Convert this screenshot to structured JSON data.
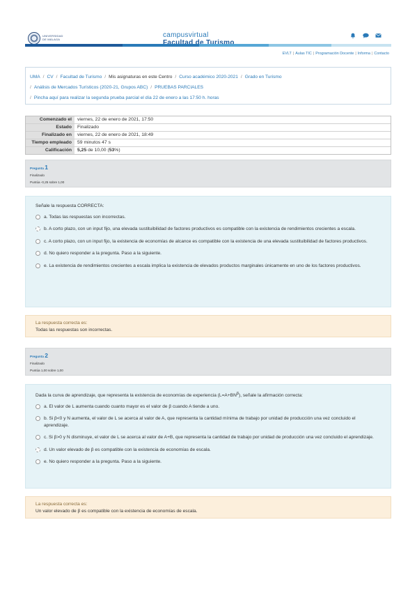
{
  "header": {
    "logo_text": [
      "UNIVERSIDAD",
      "DE MÁLAGA"
    ],
    "brand_top": "campusvirtual",
    "brand_bottom": "Facultad de Turismo",
    "icons": [
      "bell-icon",
      "chat-icon",
      "mail-icon"
    ],
    "colorbar": [
      "#1e5a9a",
      "#2a7ab8",
      "#56a7d6",
      "#8dc6e4",
      "#c7e3f1"
    ],
    "links": [
      "EVLT",
      "Aulas TIC",
      "Programación Docente",
      "Informa",
      "Contacto"
    ]
  },
  "breadcrumb": {
    "items": [
      {
        "label": "UMA",
        "link": true
      },
      {
        "label": "CV",
        "link": true
      },
      {
        "label": "Facultad de Turismo",
        "link": true
      },
      {
        "label": "Mis asignaturas en este Centro",
        "link": false
      },
      {
        "label": "Curso académico 2020-2021",
        "link": true
      },
      {
        "label": "Grado en Turismo",
        "link": true
      }
    ],
    "line2": [
      {
        "label": "Análisis de Mercados Turísticos (2020-21, Grupos ABC)",
        "link": true
      },
      {
        "label": "PRUEBAS PARCIALES",
        "link": true
      }
    ],
    "line3": [
      {
        "label": "Pincha aquí para realizar la segunda prueba parcial el día 22 de enero a las 17:50 h. horas",
        "link": true
      }
    ]
  },
  "summary": {
    "rows": [
      {
        "label": "Comenzado el",
        "value": "viernes, 22 de enero de 2021, 17:50"
      },
      {
        "label": "Estado",
        "value": "Finalizado"
      },
      {
        "label": "Finalizado en",
        "value": "viernes, 22 de enero de 2021, 18:49"
      },
      {
        "label": "Tiempo empleado",
        "value": "59 minutos 47 s"
      },
      {
        "label": "Calificación",
        "value_bold": "5,25",
        "value_mid": " de 10,00 (",
        "value_pct": "53",
        "value_end": "%)"
      }
    ]
  },
  "q1": {
    "label": "Pregunta",
    "number": "1",
    "state": "Finalizado",
    "score": "Puntúa -0,25 sobre 1,00",
    "text": "Señale la respuesta CORRECTA:",
    "options": [
      "a. Todas las respuestas son incorrectas.",
      "b. A corto plazo, con un input fijo, una elevada sustituibilidad de factores productivos es compatible con la existencia de rendimientos crecientes a escala.",
      "c. A corto plazo, con un input fijo, la existencia de economías de alcance es compatible con la existencia de una elevada sustituibilidad de factores productivos.",
      "d. No quiero responder a la pregunta. Paso a la siguiente.",
      "e. La existencia de rendimientos crecientes a escala implica la existencia de elevados productos marginales únicamente en uno de los factores productivos."
    ],
    "selected_index": 1,
    "feedback_label": "La respuesta correcta es:",
    "feedback_answer": "Todas las respuestas son incorrectas."
  },
  "q2": {
    "label": "Pregunta",
    "number": "2",
    "state": "Finalizado",
    "score": "Puntúa 1,00 sobre 1,00",
    "text": "Dada la curva de aprendizaje, que representa la existencia de economías de experiencia (L=A+BN^β), señale la afirmación correcta:",
    "options": [
      "a. El valor de L aumenta cuando cuanto mayor es el valor de β cuando A tiende a uno.",
      "b. Si β<0 y N aumenta, el valor de L se acerca al valor de A, que representa la cantidad mínima de trabajo por unidad de producción una vez concluido el aprendizaje.",
      "c. Si β>0 y N disminuye, el valor de L se acerca al valor de A+B, que representa la cantidad de trabajo por unidad de producción una vez concluido el aprendizaje.",
      "d. Un valor elevado de β es compatible con la existencia de economías de escala.",
      "e. No quiero responder a la pregunta. Paso a la siguiente."
    ],
    "selected_index": 3,
    "feedback_label": "La respuesta correcta es:",
    "feedback_answer": "Un valor elevado de β es compatible con la existencia de economías de escala."
  }
}
